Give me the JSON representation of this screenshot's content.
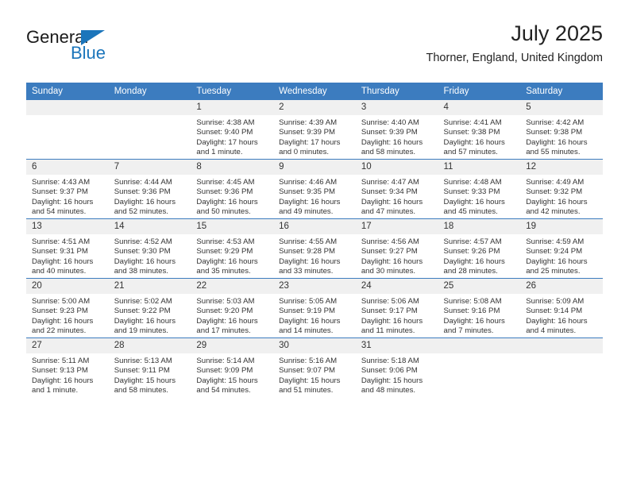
{
  "brand": {
    "name_top": "General",
    "name_bottom": "Blue",
    "triangle_color": "#1b75bb"
  },
  "header": {
    "month_year": "July 2025",
    "location": "Thorner, England, United Kingdom"
  },
  "colors": {
    "header_blue": "#3c7cbf",
    "daynum_band": "#f0f0f0",
    "text": "#333333"
  },
  "calendar": {
    "weekday_headers": [
      "Sunday",
      "Monday",
      "Tuesday",
      "Wednesday",
      "Thursday",
      "Friday",
      "Saturday"
    ],
    "labels": {
      "sunrise": "Sunrise:",
      "sunset": "Sunset:",
      "daylight": "Daylight:"
    },
    "weeks": [
      [
        {
          "day": "",
          "empty": true,
          "sunrise": "",
          "sunset": "",
          "daylight_1": "",
          "daylight_2": ""
        },
        {
          "day": "",
          "empty": true,
          "sunrise": "",
          "sunset": "",
          "daylight_1": "",
          "daylight_2": ""
        },
        {
          "day": "1",
          "sunrise": "Sunrise: 4:38 AM",
          "sunset": "Sunset: 9:40 PM",
          "daylight_1": "Daylight: 17 hours",
          "daylight_2": "and 1 minute."
        },
        {
          "day": "2",
          "sunrise": "Sunrise: 4:39 AM",
          "sunset": "Sunset: 9:39 PM",
          "daylight_1": "Daylight: 17 hours",
          "daylight_2": "and 0 minutes."
        },
        {
          "day": "3",
          "sunrise": "Sunrise: 4:40 AM",
          "sunset": "Sunset: 9:39 PM",
          "daylight_1": "Daylight: 16 hours",
          "daylight_2": "and 58 minutes."
        },
        {
          "day": "4",
          "sunrise": "Sunrise: 4:41 AM",
          "sunset": "Sunset: 9:38 PM",
          "daylight_1": "Daylight: 16 hours",
          "daylight_2": "and 57 minutes."
        },
        {
          "day": "5",
          "sunrise": "Sunrise: 4:42 AM",
          "sunset": "Sunset: 9:38 PM",
          "daylight_1": "Daylight: 16 hours",
          "daylight_2": "and 55 minutes."
        }
      ],
      [
        {
          "day": "6",
          "sunrise": "Sunrise: 4:43 AM",
          "sunset": "Sunset: 9:37 PM",
          "daylight_1": "Daylight: 16 hours",
          "daylight_2": "and 54 minutes."
        },
        {
          "day": "7",
          "sunrise": "Sunrise: 4:44 AM",
          "sunset": "Sunset: 9:36 PM",
          "daylight_1": "Daylight: 16 hours",
          "daylight_2": "and 52 minutes."
        },
        {
          "day": "8",
          "sunrise": "Sunrise: 4:45 AM",
          "sunset": "Sunset: 9:36 PM",
          "daylight_1": "Daylight: 16 hours",
          "daylight_2": "and 50 minutes."
        },
        {
          "day": "9",
          "sunrise": "Sunrise: 4:46 AM",
          "sunset": "Sunset: 9:35 PM",
          "daylight_1": "Daylight: 16 hours",
          "daylight_2": "and 49 minutes."
        },
        {
          "day": "10",
          "sunrise": "Sunrise: 4:47 AM",
          "sunset": "Sunset: 9:34 PM",
          "daylight_1": "Daylight: 16 hours",
          "daylight_2": "and 47 minutes."
        },
        {
          "day": "11",
          "sunrise": "Sunrise: 4:48 AM",
          "sunset": "Sunset: 9:33 PM",
          "daylight_1": "Daylight: 16 hours",
          "daylight_2": "and 45 minutes."
        },
        {
          "day": "12",
          "sunrise": "Sunrise: 4:49 AM",
          "sunset": "Sunset: 9:32 PM",
          "daylight_1": "Daylight: 16 hours",
          "daylight_2": "and 42 minutes."
        }
      ],
      [
        {
          "day": "13",
          "sunrise": "Sunrise: 4:51 AM",
          "sunset": "Sunset: 9:31 PM",
          "daylight_1": "Daylight: 16 hours",
          "daylight_2": "and 40 minutes."
        },
        {
          "day": "14",
          "sunrise": "Sunrise: 4:52 AM",
          "sunset": "Sunset: 9:30 PM",
          "daylight_1": "Daylight: 16 hours",
          "daylight_2": "and 38 minutes."
        },
        {
          "day": "15",
          "sunrise": "Sunrise: 4:53 AM",
          "sunset": "Sunset: 9:29 PM",
          "daylight_1": "Daylight: 16 hours",
          "daylight_2": "and 35 minutes."
        },
        {
          "day": "16",
          "sunrise": "Sunrise: 4:55 AM",
          "sunset": "Sunset: 9:28 PM",
          "daylight_1": "Daylight: 16 hours",
          "daylight_2": "and 33 minutes."
        },
        {
          "day": "17",
          "sunrise": "Sunrise: 4:56 AM",
          "sunset": "Sunset: 9:27 PM",
          "daylight_1": "Daylight: 16 hours",
          "daylight_2": "and 30 minutes."
        },
        {
          "day": "18",
          "sunrise": "Sunrise: 4:57 AM",
          "sunset": "Sunset: 9:26 PM",
          "daylight_1": "Daylight: 16 hours",
          "daylight_2": "and 28 minutes."
        },
        {
          "day": "19",
          "sunrise": "Sunrise: 4:59 AM",
          "sunset": "Sunset: 9:24 PM",
          "daylight_1": "Daylight: 16 hours",
          "daylight_2": "and 25 minutes."
        }
      ],
      [
        {
          "day": "20",
          "sunrise": "Sunrise: 5:00 AM",
          "sunset": "Sunset: 9:23 PM",
          "daylight_1": "Daylight: 16 hours",
          "daylight_2": "and 22 minutes."
        },
        {
          "day": "21",
          "sunrise": "Sunrise: 5:02 AM",
          "sunset": "Sunset: 9:22 PM",
          "daylight_1": "Daylight: 16 hours",
          "daylight_2": "and 19 minutes."
        },
        {
          "day": "22",
          "sunrise": "Sunrise: 5:03 AM",
          "sunset": "Sunset: 9:20 PM",
          "daylight_1": "Daylight: 16 hours",
          "daylight_2": "and 17 minutes."
        },
        {
          "day": "23",
          "sunrise": "Sunrise: 5:05 AM",
          "sunset": "Sunset: 9:19 PM",
          "daylight_1": "Daylight: 16 hours",
          "daylight_2": "and 14 minutes."
        },
        {
          "day": "24",
          "sunrise": "Sunrise: 5:06 AM",
          "sunset": "Sunset: 9:17 PM",
          "daylight_1": "Daylight: 16 hours",
          "daylight_2": "and 11 minutes."
        },
        {
          "day": "25",
          "sunrise": "Sunrise: 5:08 AM",
          "sunset": "Sunset: 9:16 PM",
          "daylight_1": "Daylight: 16 hours",
          "daylight_2": "and 7 minutes."
        },
        {
          "day": "26",
          "sunrise": "Sunrise: 5:09 AM",
          "sunset": "Sunset: 9:14 PM",
          "daylight_1": "Daylight: 16 hours",
          "daylight_2": "and 4 minutes."
        }
      ],
      [
        {
          "day": "27",
          "sunrise": "Sunrise: 5:11 AM",
          "sunset": "Sunset: 9:13 PM",
          "daylight_1": "Daylight: 16 hours",
          "daylight_2": "and 1 minute."
        },
        {
          "day": "28",
          "sunrise": "Sunrise: 5:13 AM",
          "sunset": "Sunset: 9:11 PM",
          "daylight_1": "Daylight: 15 hours",
          "daylight_2": "and 58 minutes."
        },
        {
          "day": "29",
          "sunrise": "Sunrise: 5:14 AM",
          "sunset": "Sunset: 9:09 PM",
          "daylight_1": "Daylight: 15 hours",
          "daylight_2": "and 54 minutes."
        },
        {
          "day": "30",
          "sunrise": "Sunrise: 5:16 AM",
          "sunset": "Sunset: 9:07 PM",
          "daylight_1": "Daylight: 15 hours",
          "daylight_2": "and 51 minutes."
        },
        {
          "day": "31",
          "sunrise": "Sunrise: 5:18 AM",
          "sunset": "Sunset: 9:06 PM",
          "daylight_1": "Daylight: 15 hours",
          "daylight_2": "and 48 minutes."
        },
        {
          "day": "",
          "empty": true,
          "sunrise": "",
          "sunset": "",
          "daylight_1": "",
          "daylight_2": ""
        },
        {
          "day": "",
          "empty": true,
          "sunrise": "",
          "sunset": "",
          "daylight_1": "",
          "daylight_2": ""
        }
      ]
    ]
  }
}
